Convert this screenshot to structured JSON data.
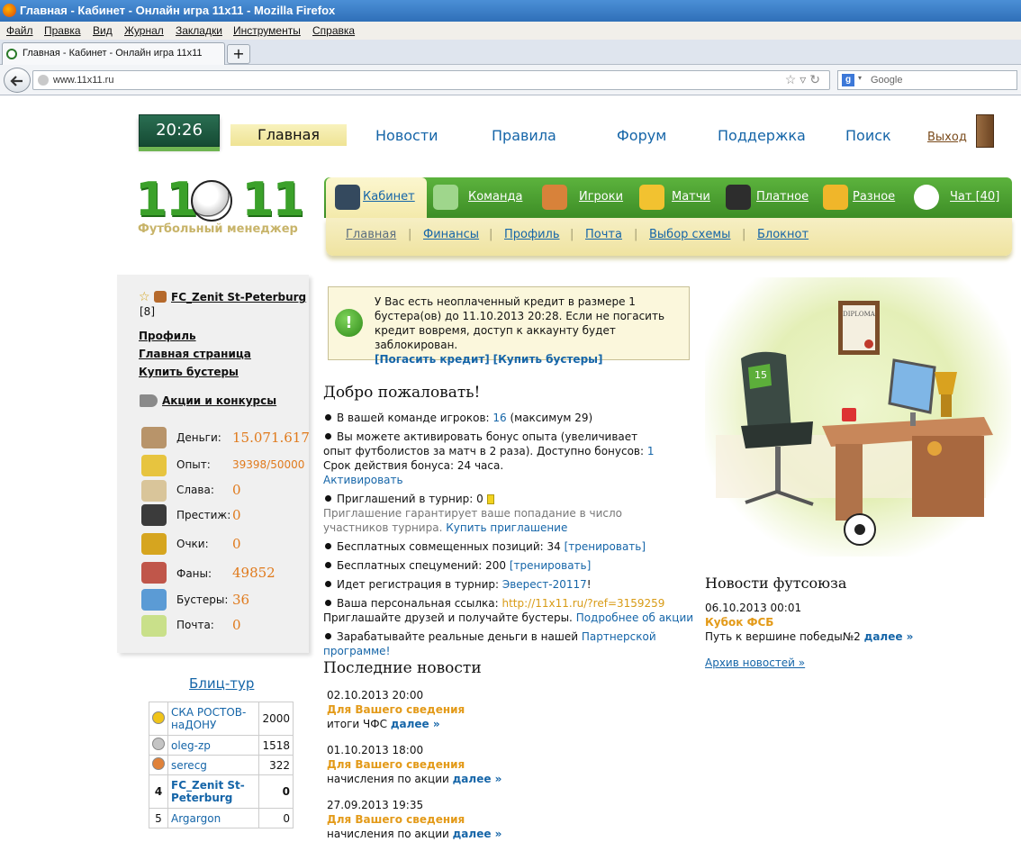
{
  "browser": {
    "window_title": "Главная - Кабинет - Онлайн игра 11x11 - Mozilla Firefox",
    "menu": [
      "Файл",
      "Правка",
      "Вид",
      "Журнал",
      "Закладки",
      "Инструменты",
      "Справка"
    ],
    "tab_title": "Главная - Кабинет - Онлайн игра 11x11",
    "new_tab": "+",
    "url": "www.11x11.ru",
    "search_placeholder": "Google"
  },
  "header": {
    "clock": "20:26",
    "nav": [
      "Главная",
      "Новости",
      "Правила",
      "Форум",
      "Поддержка",
      "Поиск"
    ],
    "logout": "Выход",
    "logo": "11",
    "logo_right": "11",
    "logo_subtitle": "Футбольный менеджер"
  },
  "main_menu": [
    {
      "label": "Кабинет",
      "icon": "manager-icon"
    },
    {
      "label": "Команда",
      "icon": "stadium-icon"
    },
    {
      "label": "Игроки",
      "icon": "players-icon"
    },
    {
      "label": "Матчи",
      "icon": "trophy-ball-icon"
    },
    {
      "label": "Платное",
      "icon": "coins-icon"
    },
    {
      "label": "Разное",
      "icon": "beer-icon"
    },
    {
      "label": "Чат [40]",
      "icon": "chat-icon"
    }
  ],
  "sub_menu": [
    "Главная",
    "Финансы",
    "Профиль",
    "Почта",
    "Выбор схемы",
    "Блокнот"
  ],
  "sub_sep": "|",
  "left_panel": {
    "club_name": "FC_Zenit St-Peterburg",
    "club_level": "[8]",
    "links": [
      "Профиль",
      "Главная страница",
      "Купить бустеры"
    ],
    "promo": "Акции и конкурсы",
    "stats": [
      {
        "label": "Деньги:",
        "value": "15.071.617",
        "icon": "money-bag-icon"
      },
      {
        "label": "Опыт:",
        "value": "39398/50000",
        "icon": "experience-icon"
      },
      {
        "label": "Слава:",
        "value": "0",
        "icon": "podium-icon"
      },
      {
        "label": "Престиж:",
        "value": "0",
        "icon": "prestige-icon"
      },
      {
        "label": "Очки:",
        "value": "0",
        "icon": "cup-icon"
      },
      {
        "label": "Фаны:",
        "value": "49852",
        "icon": "fans-icon"
      },
      {
        "label": "Бустеры:",
        "value": "36",
        "icon": "booster-icon"
      },
      {
        "label": "Почта:",
        "value": "0",
        "icon": "mail-icon"
      }
    ]
  },
  "blitz": {
    "title": "Блиц-тур",
    "rows": [
      {
        "place": "1",
        "name": "СКА РОСТОВ-наДОНУ",
        "score": "2000"
      },
      {
        "place": "2",
        "name": "oleg-zp",
        "score": "1518"
      },
      {
        "place": "3",
        "name": "serecg",
        "score": "322"
      },
      {
        "place": "4",
        "name": "FC_Zenit St-Peterburg",
        "score": "0"
      },
      {
        "place": "5",
        "name": "Argargon",
        "score": "0"
      }
    ]
  },
  "alert": {
    "text": "У Вас есть неоплаченный кредит в размере 1 бустера(ов) до 11.10.2013 20:28. Если не погасить кредит вовремя, доступ к аккаунту будет заблокирован.",
    "link1": "[Погасить кредит]",
    "link2": "[Купить бустеры]"
  },
  "welcome": {
    "title": "Добро пожаловать!",
    "players_pre": "В вашей команде игроков: ",
    "players_link": "16",
    "players_post": " (максимум 29)",
    "bonus_text": "Вы можете активировать бонус опыта (увеличивает опыт футболистов за матч в 2 раза). Доступно бонусов: ",
    "bonus_link": "1",
    "bonus_period": "Срок действия бонуса: 24 часа.",
    "bonus_activate": "Активировать",
    "invites": "Приглашений в турнир: 0",
    "invites_note": "Приглашение гарантирует ваше попадание в число участников турнира.",
    "invites_buy": "Купить приглашение",
    "positions_text": "Бесплатных совмещенных позиций: 34 ",
    "positions_link": "[тренировать]",
    "skills_text": "Бесплатных спецумений: 200 ",
    "skills_link": "[тренировать]",
    "tournament_text": "Идет регистрация в турнир: ",
    "tournament_link": "Эверест-20117",
    "tournament_post": "!",
    "ref_text": "Ваша персональная ссылка: ",
    "ref_link": "http://11x11.ru/?ref=3159259",
    "ref_invite": "Приглашайте друзей и получайте бустеры. ",
    "ref_more": "Подробнее об акции",
    "earn_text": "Зарабатывайте реальные деньги в нашей ",
    "earn_link": "Партнерской программе!"
  },
  "news": {
    "title": "Последние новости",
    "items": [
      {
        "date": "02.10.2013 20:00",
        "head": "Для Вашего сведения",
        "body": "итоги ЧФС ",
        "more": "далее »"
      },
      {
        "date": "01.10.2013 18:00",
        "head": "Для Вашего сведения",
        "body": "начисления по акции ",
        "more": "далее »"
      },
      {
        "date": "27.09.2013 19:35",
        "head": "Для Вашего сведения",
        "body": "начисления по акции ",
        "more": "далее »"
      }
    ]
  },
  "futsal": {
    "title": "Новости футсоюза",
    "date": "06.10.2013 00:01",
    "head": "Кубок ФСБ",
    "body": "Путь к вершине победы№2 ",
    "more": "далее »",
    "archive": "Архив новостей »"
  },
  "illustration": {
    "diploma_text": "DIPLOMA",
    "jersey_number": "15"
  },
  "colors": {
    "green": "#3d8d26",
    "orange": "#e07a1c",
    "link": "#1565a8",
    "cream": "#f4eaab"
  }
}
